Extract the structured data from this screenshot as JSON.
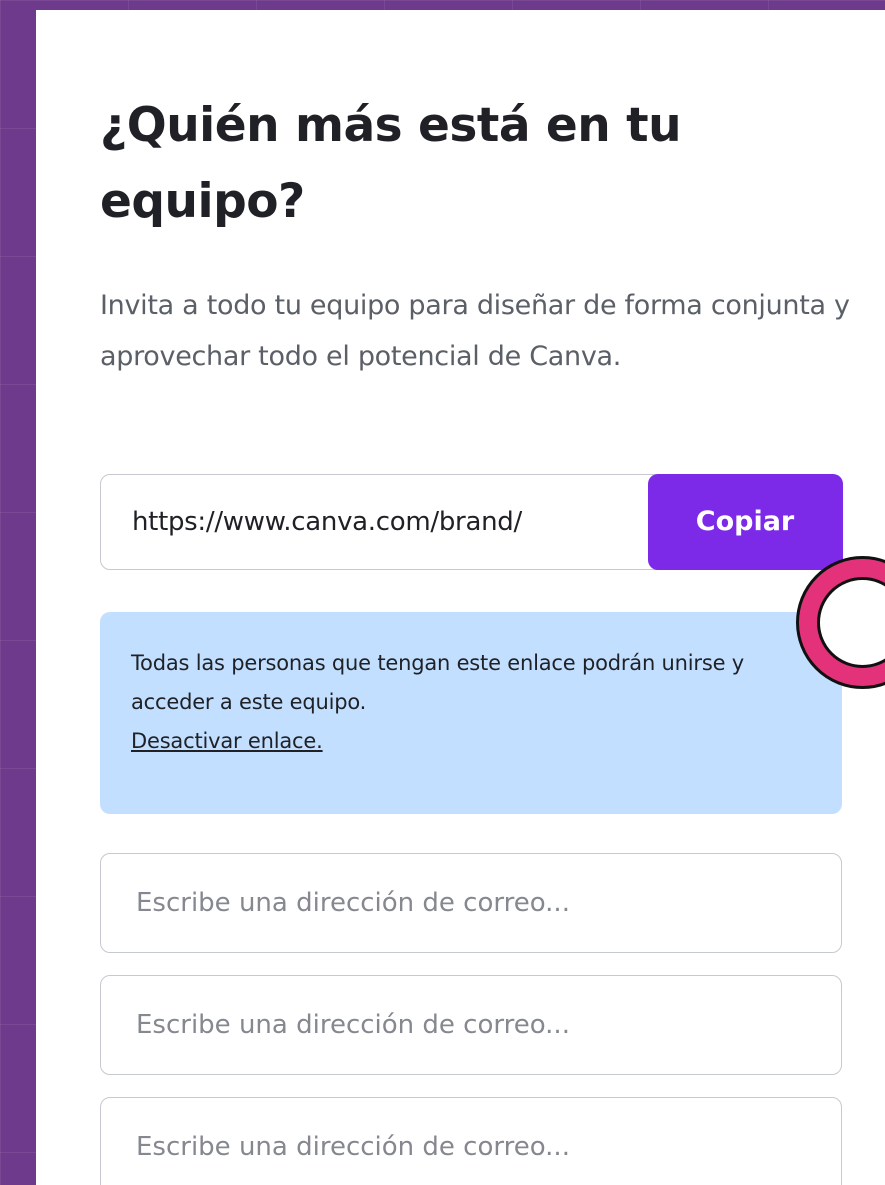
{
  "dialog": {
    "title": "¿Quién más está en tu equipo?",
    "description": "Invita a todo tu equipo para diseñar de forma conjunta y aprovechar todo el potencial de Canva."
  },
  "invite_link": {
    "value": "https://www.canva.com/brand/",
    "copy_label": "Copiar"
  },
  "notice": {
    "text": "Todas las personas que tengan este enlace podrán unirse y acceder a este equipo.",
    "link_label": "Desactivar enlace."
  },
  "email_fields": [
    {
      "placeholder": "Escribe una dirección de correo..."
    },
    {
      "placeholder": "Escribe una dirección de correo..."
    },
    {
      "placeholder": "Escribe una dirección de correo..."
    }
  ],
  "colors": {
    "background": "#6e3a8c",
    "accent": "#7d2ae8",
    "notice_background": "#c2dfff",
    "highlight_ring": "#e3327a"
  },
  "annotation": {
    "icon": "highlight-ring-icon"
  }
}
